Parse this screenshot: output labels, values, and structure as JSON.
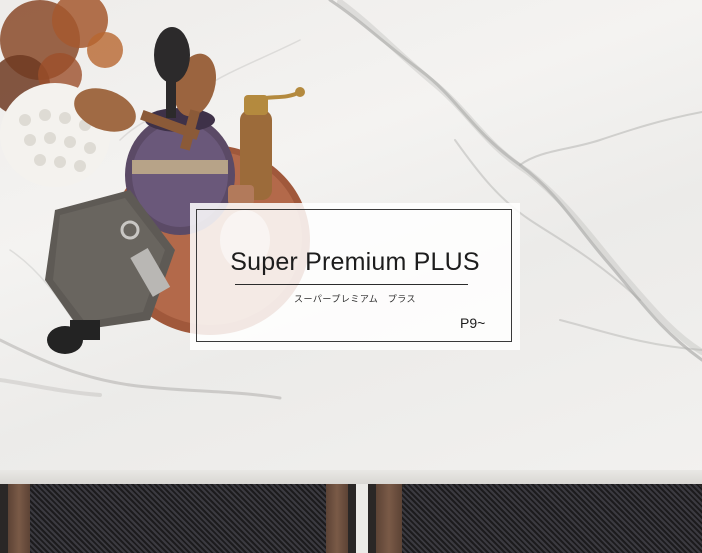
{
  "card": {
    "title": "Super Premium PLUS",
    "subtitle": "スーパープレミアム　プラス",
    "page": "P9~"
  },
  "colors": {
    "marble": "#efeeec",
    "vein": "#9a9a9a",
    "card_background": "#ffffff",
    "card_border": "#3a3a3a",
    "text": "#1d1d1d",
    "chair_wicker": "#2b2a2e",
    "chair_frame": "#6b4e3d"
  }
}
